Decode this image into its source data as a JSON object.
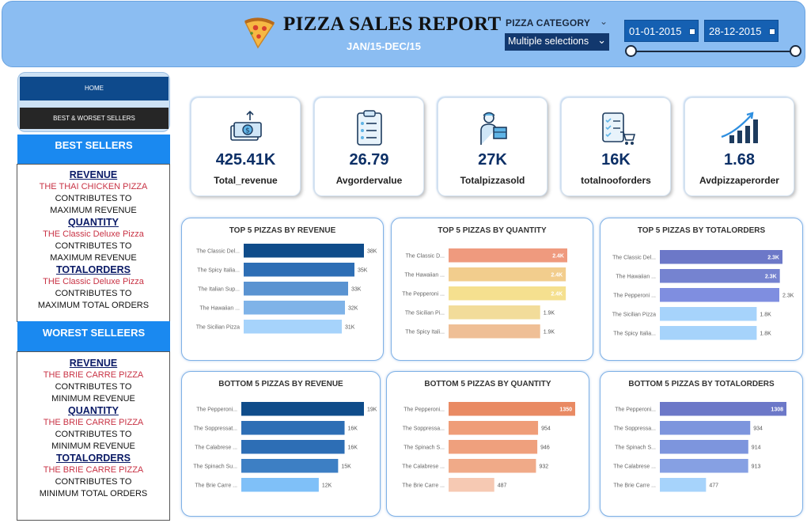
{
  "header": {
    "title": "PIZZA SALES REPORT",
    "subtitle": "JAN/15-DEC/15",
    "category_label": "PIZZA CATEGORY",
    "category_value": "Multiple selections",
    "date_from": "01-01-2015",
    "date_to": "28-12-2015"
  },
  "nav": {
    "home": "HOME",
    "best_worst": "BEST & WORSET SELLERS"
  },
  "best": {
    "heading": "BEST SELLERS",
    "revenue_head": "REVENUE",
    "revenue_item": "THE THAI CHICKEN PIZZA",
    "revenue_l1": "CONTRIBUTES TO",
    "revenue_l2": "MAXIMUM REVENUE",
    "quantity_head": "QUANTITY",
    "quantity_item": "THE  Classic Deluxe Pizza",
    "quantity_l1": "CONTRIBUTES TO",
    "quantity_l2": "MAXIMUM REVENUE",
    "orders_head": "TOTALORDERS",
    "orders_item": "THE  Classic Deluxe Pizza",
    "orders_l1": "CONTRIBUTES TO",
    "orders_l2": "MAXIMUM TOTAL ORDERS"
  },
  "worst": {
    "heading": "WOREST SELLEERS",
    "revenue_head": "REVENUE",
    "revenue_item": "THE BRIE CARRE PIZZA",
    "revenue_l1": "CONTRIBUTES TO",
    "revenue_l2": "MINIMUM REVENUE",
    "quantity_head": "QUANTITY",
    "quantity_item": "THE BRIE CARRE PIZZA",
    "quantity_l1": "CONTRIBUTES TO",
    "quantity_l2": "MINIMUM REVENUE",
    "orders_head": "TOTALORDERS",
    "orders_item": "THE BRIE CARRE PIZZA",
    "orders_l1": "CONTRIBUTES TO",
    "orders_l2": "MINIMUM TOTAL ORDERS"
  },
  "kpis": [
    {
      "value": "425.41K",
      "label": "Total_revenue",
      "icon": "money-icon"
    },
    {
      "value": "26.79",
      "label": "Avgordervalue",
      "icon": "clipboard-icon"
    },
    {
      "value": "27K",
      "label": "Totalpizzasold",
      "icon": "delivery-person-icon"
    },
    {
      "value": "16K",
      "label": "totalnooforders",
      "icon": "checklist-cart-icon"
    },
    {
      "value": "1.68",
      "label": "Avdpizzaperorder",
      "icon": "growth-chart-icon"
    }
  ],
  "chart_data": [
    {
      "type": "bar",
      "orientation": "horizontal",
      "title": "TOP 5 PIZZAS BY REVENUE",
      "categories": [
        "The Classic Del...",
        "The Spicy Italia...",
        "The Italian Sup...",
        "The Hawaiian ...",
        "The Sicilian Pizza"
      ],
      "values": [
        38,
        35,
        33,
        32,
        31
      ],
      "labels": [
        "38K",
        "35K",
        "33K",
        "32K",
        "31K"
      ],
      "colors": [
        "#0f4c8a",
        "#2d6eb5",
        "#5a93d1",
        "#7fb3e8",
        "#a6d3fb"
      ]
    },
    {
      "type": "bar",
      "orientation": "horizontal",
      "title": "TOP 5 PIZZAS BY QUANTITY",
      "categories": [
        "The Classic D...",
        "The Hawaiian ...",
        "The Pepperoni ...",
        "The Sicilian Pi...",
        "The Spicy Itali..."
      ],
      "values": [
        2.45,
        2.42,
        2.42,
        1.89,
        1.89
      ],
      "labels": [
        "2.4K",
        "2.4K",
        "2.4K",
        "1.9K",
        "1.9K"
      ],
      "colors": [
        "#ef9a7e",
        "#f2cd8d",
        "#f5e08f",
        "#f2dc9a",
        "#efbf96"
      ]
    },
    {
      "type": "bar",
      "orientation": "horizontal",
      "title": "TOP 5 PIZZAS BY TOTALORDERS",
      "categories": [
        "The Classic Del...",
        "The Hawaiian ...",
        "The Pepperoni ...",
        "The Sicilian Pizza",
        "The Spicy Italia..."
      ],
      "values": [
        2.33,
        2.28,
        2.27,
        1.84,
        1.84
      ],
      "labels": [
        "2.3K",
        "2.3K",
        "2.3K",
        "1.8K",
        "1.8K"
      ],
      "colors": [
        "#6c78c8",
        "#7583d0",
        "#7f8ee0",
        "#a6d3fb",
        "#a6d3fb"
      ]
    },
    {
      "type": "bar",
      "orientation": "horizontal",
      "title": "BOTTOM 5 PIZZAS BY REVENUE",
      "categories": [
        "The Pepperoni...",
        "The Soppressat...",
        "The Calabrese ...",
        "The Spinach Su...",
        "The Brie Carre ..."
      ],
      "values": [
        19,
        16,
        16,
        15,
        12
      ],
      "labels": [
        "19K",
        "16K",
        "16K",
        "15K",
        "12K"
      ],
      "colors": [
        "#0f4c8a",
        "#2d6eb5",
        "#2d6eb5",
        "#3d7fc4",
        "#7fc0f8"
      ]
    },
    {
      "type": "bar",
      "orientation": "horizontal",
      "title": "BOTTOM 5 PIZZAS BY QUANTITY",
      "categories": [
        "The Pepperoni...",
        "The Soppressa...",
        "The Spinach S...",
        "The Calabrese ...",
        "The Brie Carre ..."
      ],
      "values": [
        1350,
        954,
        946,
        932,
        487
      ],
      "labels": [
        "1350",
        "954",
        "946",
        "932",
        "487"
      ],
      "colors": [
        "#e98a63",
        "#ef9d78",
        "#efa07d",
        "#f0aa88",
        "#f6c9b3"
      ]
    },
    {
      "type": "bar",
      "orientation": "horizontal",
      "title": "BOTTOM 5 PIZZAS BY TOTALORDERS",
      "categories": [
        "The Pepperoni...",
        "The Soppressa...",
        "The Spinach S...",
        "The Calabrese ...",
        "The Brie Carre ..."
      ],
      "values": [
        1308,
        934,
        914,
        913,
        477
      ],
      "labels": [
        "1308",
        "934",
        "914",
        "913",
        "477"
      ],
      "colors": [
        "#6c78c8",
        "#7d95dd",
        "#7d95dd",
        "#86a0e3",
        "#a6d3fb"
      ]
    }
  ]
}
